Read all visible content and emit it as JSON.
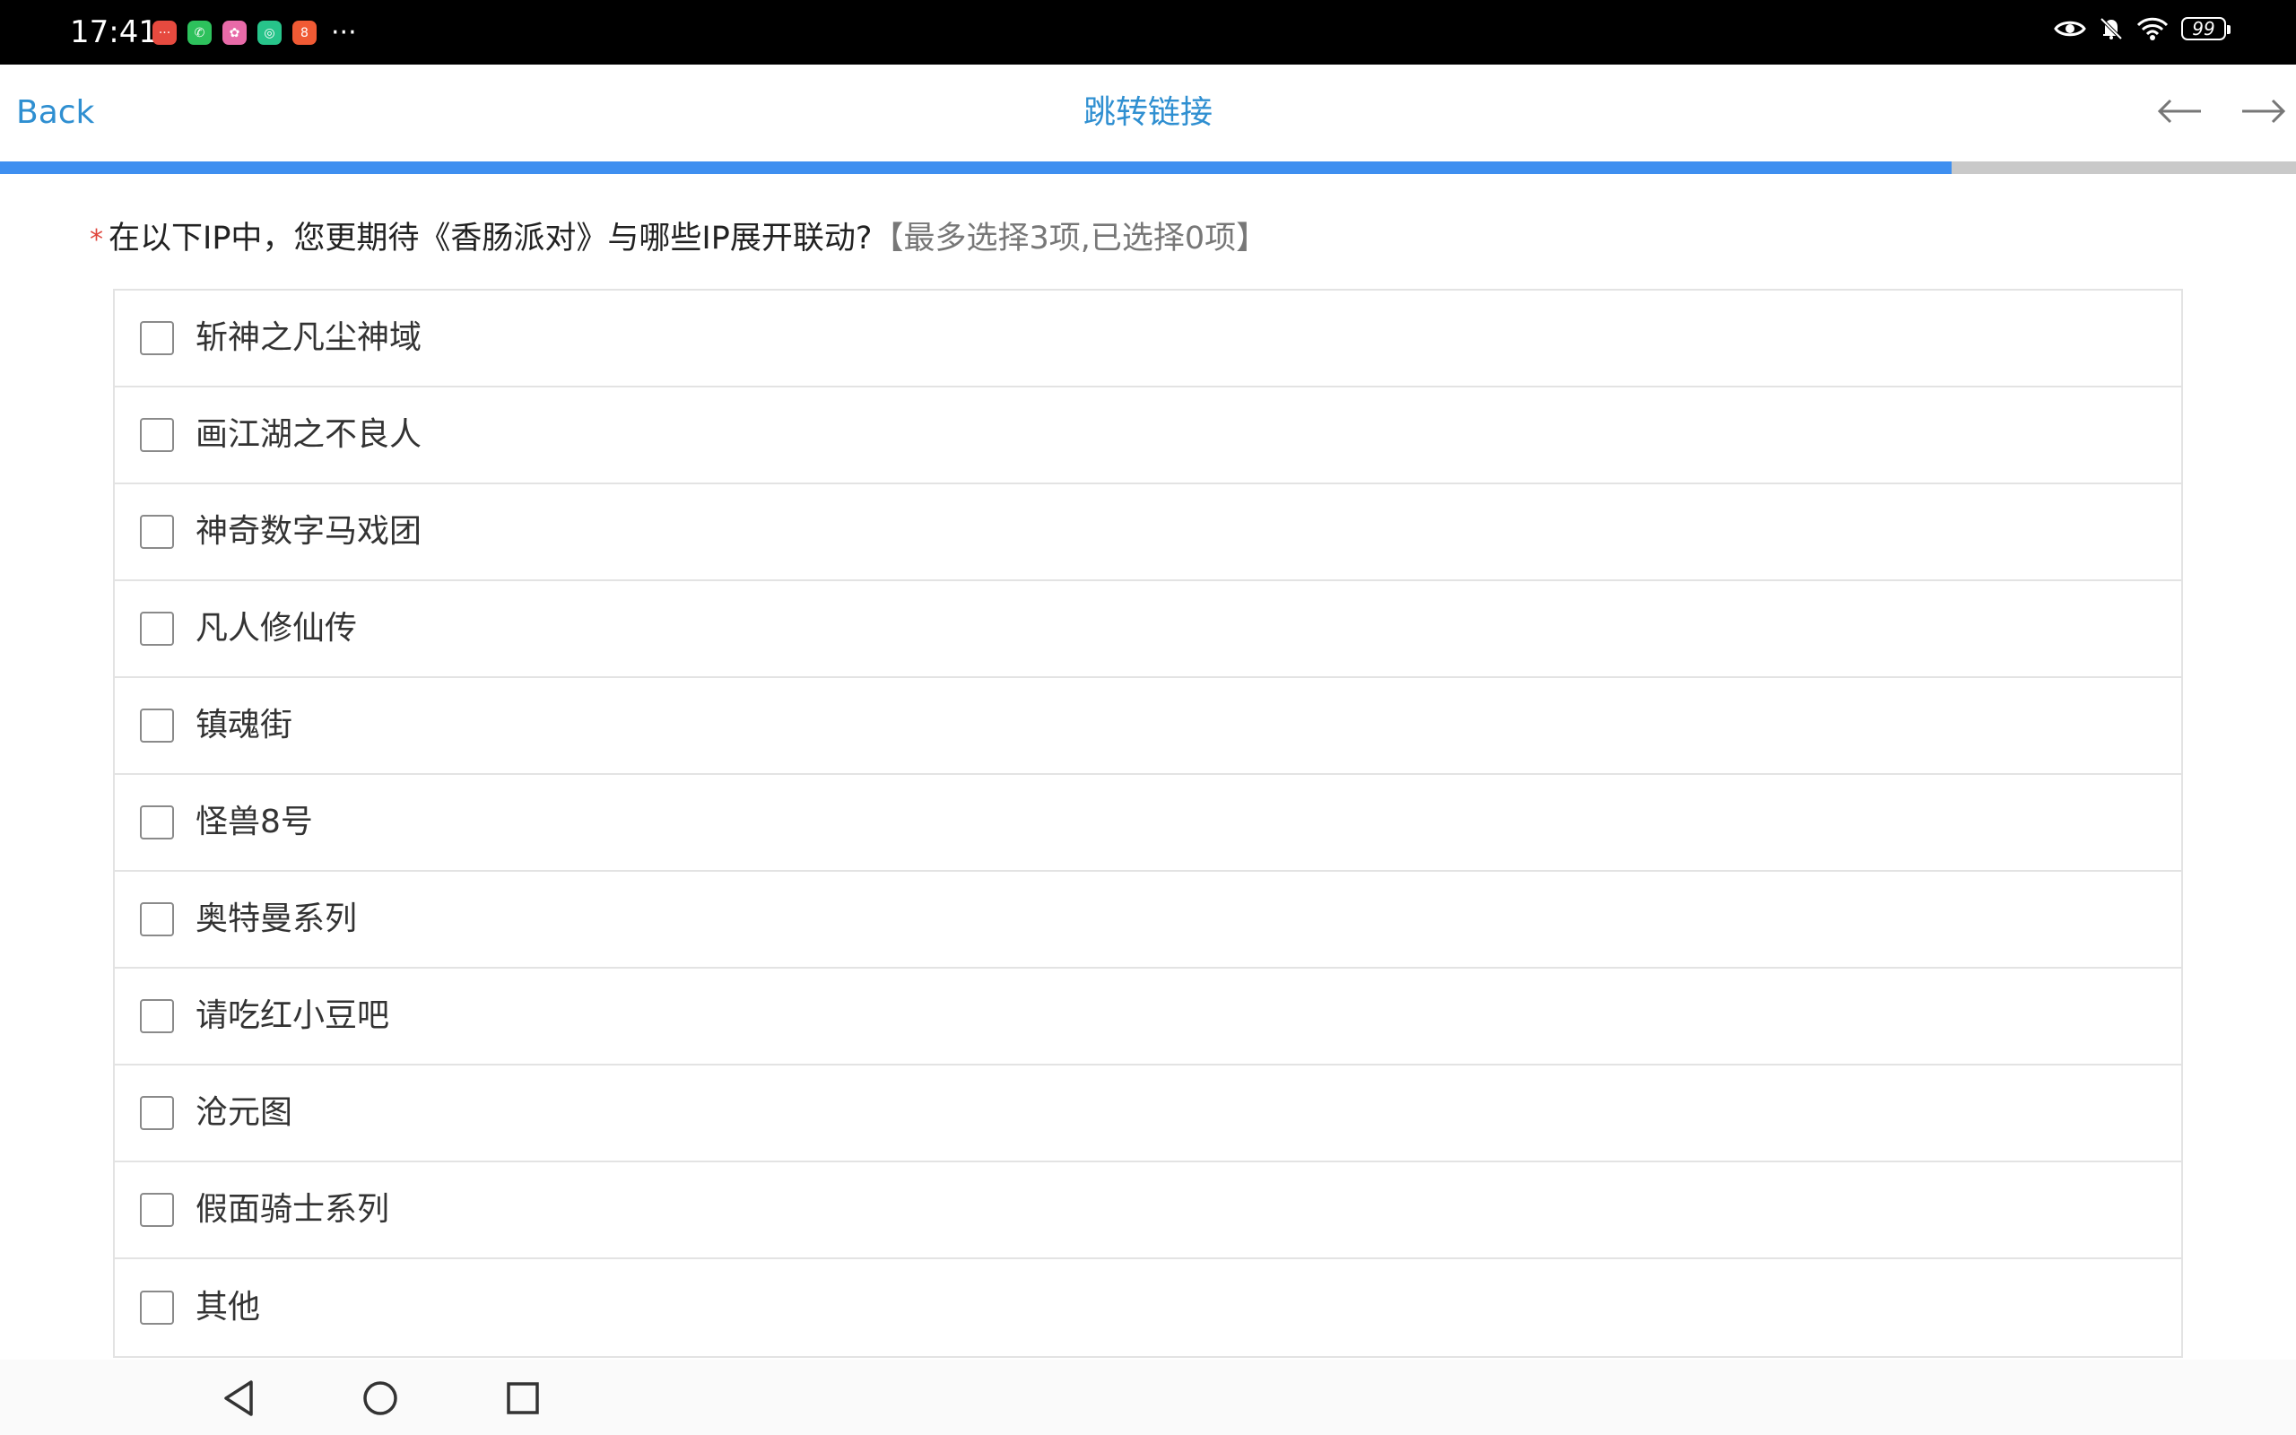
{
  "status_bar": {
    "time": "17:41",
    "app_icons": [
      {
        "name": "app-red-icon",
        "color": "#e64a3f",
        "glyph": "···"
      },
      {
        "name": "wechat-icon",
        "color": "#2dc15c",
        "glyph": "✆"
      },
      {
        "name": "app-colorful-icon",
        "color": "#e86aa8",
        "glyph": "✿"
      },
      {
        "name": "camera-app-icon",
        "color": "#27c48a",
        "glyph": "◎"
      },
      {
        "name": "app-orange-icon",
        "color": "#f05a34",
        "glyph": "8"
      }
    ],
    "more": "···",
    "battery_level": "99"
  },
  "header": {
    "back_label": "Back",
    "title": "跳转链接"
  },
  "progress": {
    "fraction": 0.85,
    "fill_color": "#3e8ff0",
    "track_color": "#c9c9c9"
  },
  "question": {
    "required_mark": "*",
    "text": "在以下IP中，您更期待《香肠派对》与哪些IP展开联动?",
    "hint": "【最多选择3项,已选择0项】"
  },
  "options": [
    {
      "label": "斩神之凡尘神域",
      "checked": false
    },
    {
      "label": "画江湖之不良人",
      "checked": false
    },
    {
      "label": "神奇数字马戏团",
      "checked": false
    },
    {
      "label": "凡人修仙传",
      "checked": false
    },
    {
      "label": "镇魂街",
      "checked": false
    },
    {
      "label": "怪兽8号",
      "checked": false
    },
    {
      "label": "奥特曼系列",
      "checked": false
    },
    {
      "label": "请吃红小豆吧",
      "checked": false
    },
    {
      "label": "沧元图",
      "checked": false
    },
    {
      "label": "假面骑士系列",
      "checked": false
    },
    {
      "label": "其他",
      "checked": false
    }
  ],
  "colors": {
    "accent": "#2f8fd1",
    "required": "#e0463d"
  }
}
